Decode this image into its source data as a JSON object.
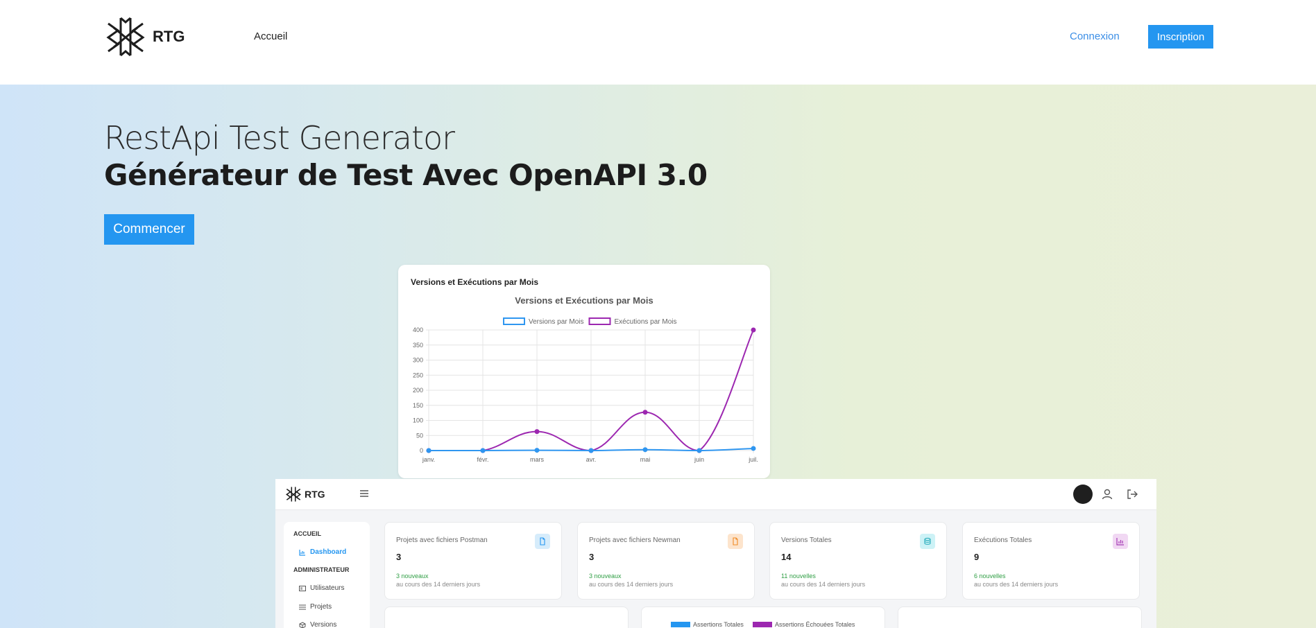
{
  "nav": {
    "brand": "RTG",
    "home_link": "Accueil",
    "login_link": "Connexion",
    "signup_button": "Inscription"
  },
  "hero": {
    "title": "RestApi Test Generator",
    "subtitle": "Générateur de Test Avec OpenAPI 3.0",
    "start_button": "Commencer"
  },
  "chart_card": {
    "card_title": "Versions et Exécutions par Mois"
  },
  "chart_data": {
    "type": "line",
    "title": "Versions et Exécutions par Mois",
    "xlabel": "",
    "ylabel": "",
    "categories": [
      "janv.",
      "févr.",
      "mars",
      "avr.",
      "mai",
      "juin",
      "juil."
    ],
    "ylim": [
      0,
      400
    ],
    "yticks": [
      0,
      50,
      100,
      150,
      200,
      250,
      300,
      350,
      400
    ],
    "grid": true,
    "legend_position": "top",
    "series": [
      {
        "name": "Versions par Mois",
        "values": [
          0,
          0,
          1,
          0,
          3,
          0,
          7
        ],
        "color": "#2f96f0"
      },
      {
        "name": "Exécutions par Mois",
        "values": [
          0,
          0,
          63,
          0,
          127,
          0,
          400
        ],
        "color": "#9c27b0"
      }
    ]
  },
  "dashboard": {
    "brand": "RTG",
    "sidebar": {
      "section_home": "ACCUEIL",
      "item_dashboard": "Dashboard",
      "section_admin": "ADMINISTRATEUR",
      "item_users": "Utilisateurs",
      "item_projects": "Projets",
      "item_versions": "Versions"
    },
    "stats": [
      {
        "label": "Projets avec fichiers Postman",
        "value": "3",
        "new": "3 nouveaux",
        "sub": "au cours des 14 derniers jours",
        "icon": "file-icon",
        "icon_bg": "#d6ecfb",
        "icon_color": "#2496f0"
      },
      {
        "label": "Projets avec fichiers Newman",
        "value": "3",
        "new": "3 nouveaux",
        "sub": "au cours des 14 derniers jours",
        "icon": "file-icon",
        "icon_bg": "#fde4cc",
        "icon_color": "#f08a24"
      },
      {
        "label": "Versions Totales",
        "value": "14",
        "new": "11 nouvelles",
        "sub": "au cours des 14 derniers jours",
        "icon": "database-icon",
        "icon_bg": "#cdf2f6",
        "icon_color": "#1aa6b7"
      },
      {
        "label": "Exécutions Totales",
        "value": "9",
        "new": "6 nouvelles",
        "sub": "au cours des 14 derniers jours",
        "icon": "chart-icon",
        "icon_bg": "#f1d8f3",
        "icon_color": "#a53bb5"
      }
    ],
    "lower_legend": {
      "total_assertions": "Assertions Totales",
      "failed_assertions": "Assertions Échouées Totales"
    }
  }
}
